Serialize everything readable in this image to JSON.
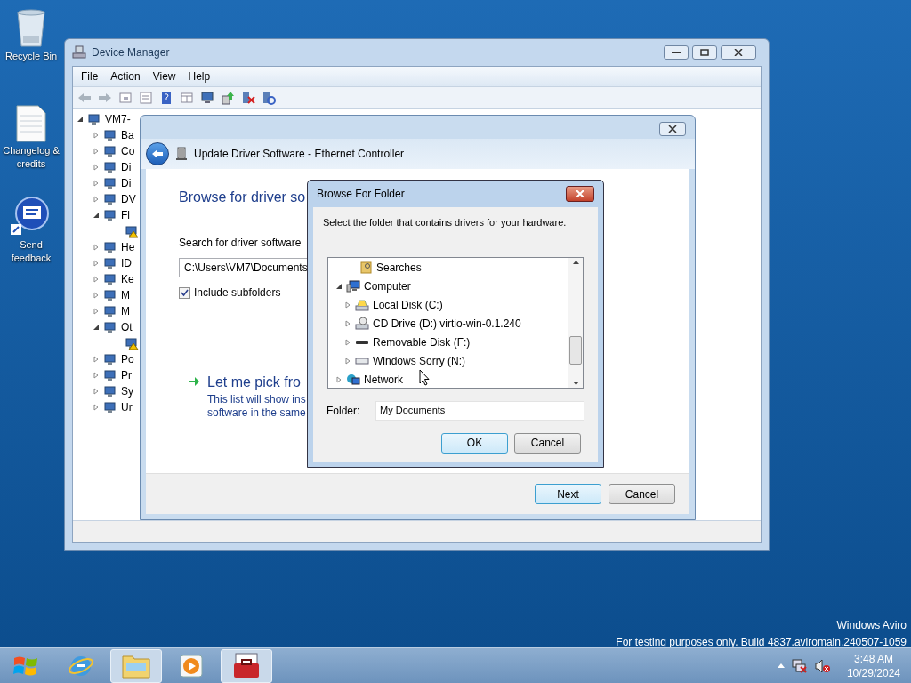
{
  "desktop_icons": [
    {
      "label": "Recycle Bin",
      "kind": "recycle"
    },
    {
      "label": "Changelog & credits",
      "kind": "document"
    },
    {
      "label": "Send feedback",
      "kind": "feedback"
    }
  ],
  "device_manager": {
    "title": "Device Manager",
    "menu": [
      "File",
      "Action",
      "View",
      "Help"
    ],
    "tree": {
      "label": "VM7-",
      "expanded": true,
      "children": [
        {
          "label": "Ba",
          "expanded": false
        },
        {
          "label": "Co",
          "expanded": false
        },
        {
          "label": "Di",
          "expanded": false
        },
        {
          "label": "Di",
          "expanded": false
        },
        {
          "label": "DV",
          "expanded": false
        },
        {
          "label": "Fl",
          "expanded": true,
          "children": [
            {
              "warning": true
            }
          ]
        },
        {
          "label": "He",
          "expanded": false
        },
        {
          "label": "ID",
          "expanded": false
        },
        {
          "label": "Ke",
          "expanded": false
        },
        {
          "label": "M",
          "expanded": false
        },
        {
          "label": "M",
          "expanded": false
        },
        {
          "label": "Ot",
          "expanded": true,
          "children": [
            {
              "warning": true
            }
          ]
        },
        {
          "label": "Po",
          "expanded": false
        },
        {
          "label": "Pr",
          "expanded": false
        },
        {
          "label": "Sy",
          "expanded": false
        },
        {
          "label": "Ur",
          "expanded": false
        }
      ]
    }
  },
  "update_dialog": {
    "title": "Update Driver Software - Ethernet Controller",
    "heading": "Browse for driver so",
    "search_label": "Search for driver software",
    "path_value": "C:\\Users\\VM7\\Documents",
    "include_subfolders": {
      "label": "Include subfolders",
      "checked": true
    },
    "option": {
      "title": "Let me pick fro",
      "description": [
        "This list will show ins",
        "software in the same"
      ]
    },
    "buttons": [
      {
        "label": "Next",
        "default": true
      },
      {
        "label": "Cancel",
        "default": false
      }
    ]
  },
  "browse_dialog": {
    "title": "Browse For Folder",
    "instruction": "Select the folder that contains drivers for your hardware.",
    "tree": [
      {
        "label": "Searches",
        "kind": "folder"
      },
      {
        "label": "Computer",
        "kind": "computer",
        "expanded": true,
        "children": [
          {
            "label": "Local Disk (C:)",
            "kind": "system-disk",
            "expanded": false
          },
          {
            "label": "CD Drive (D:) virtio-win-0.1.240",
            "kind": "cd",
            "expanded": false
          },
          {
            "label": "Removable Disk (F:)",
            "kind": "removable",
            "expanded": false
          },
          {
            "label": "Windows Sorry (N:)",
            "kind": "drive",
            "expanded": false
          }
        ]
      },
      {
        "label": "Network",
        "kind": "network",
        "expanded": false
      }
    ],
    "folder_label": "Folder:",
    "folder_value": "My Documents",
    "buttons": [
      {
        "label": "OK",
        "default": true
      },
      {
        "label": "Cancel",
        "default": false
      }
    ]
  },
  "watermark": [
    "Windows Aviro",
    "For testing purposes only. Build 4837.aviromain.240507-1059"
  ],
  "taskbar": {
    "apps": [
      {
        "kind": "browser",
        "running": false
      },
      {
        "kind": "explorer",
        "running": true
      },
      {
        "kind": "media",
        "running": false
      },
      {
        "kind": "toolbox",
        "running": true
      }
    ],
    "clock": {
      "time": "3:48 AM",
      "date": "10/29/2024"
    }
  }
}
